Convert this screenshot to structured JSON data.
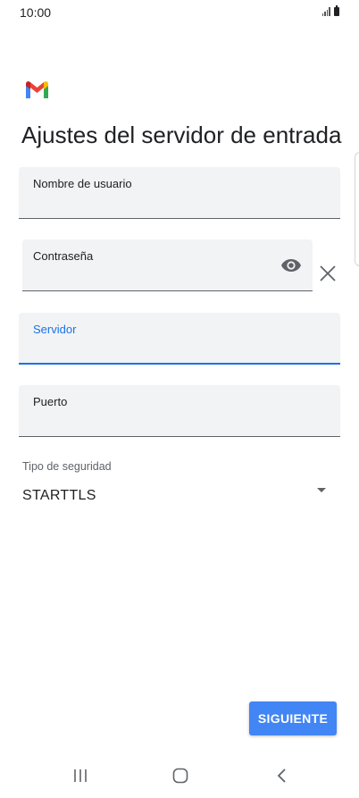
{
  "status_bar": {
    "time": "10:00",
    "signal_icon": "signal-icon",
    "battery_icon": "battery-icon"
  },
  "header": {
    "logo_icon": "gmail-logo-icon",
    "title": "Ajustes del servidor de entrada"
  },
  "form": {
    "username": {
      "label": "Nombre de usuario",
      "value": ""
    },
    "password": {
      "label": "Contraseña",
      "value": "",
      "toggle_icon": "eye-icon",
      "clear_icon": "close-icon"
    },
    "server": {
      "label": "Servidor",
      "value": "",
      "focused": true
    },
    "port": {
      "label": "Puerto",
      "value": ""
    },
    "security": {
      "label": "Tipo de seguridad",
      "selected": "STARTTLS",
      "caret_icon": "dropdown-arrow-icon"
    }
  },
  "actions": {
    "next_label": "SIGUIENTE"
  },
  "nav": {
    "recents_icon": "recents-icon",
    "home_icon": "home-icon",
    "back_icon": "back-icon"
  },
  "colors": {
    "accent": "#1a73e8",
    "button": "#4285f4",
    "field_background": "#f1f3f4",
    "text": "#202124"
  }
}
